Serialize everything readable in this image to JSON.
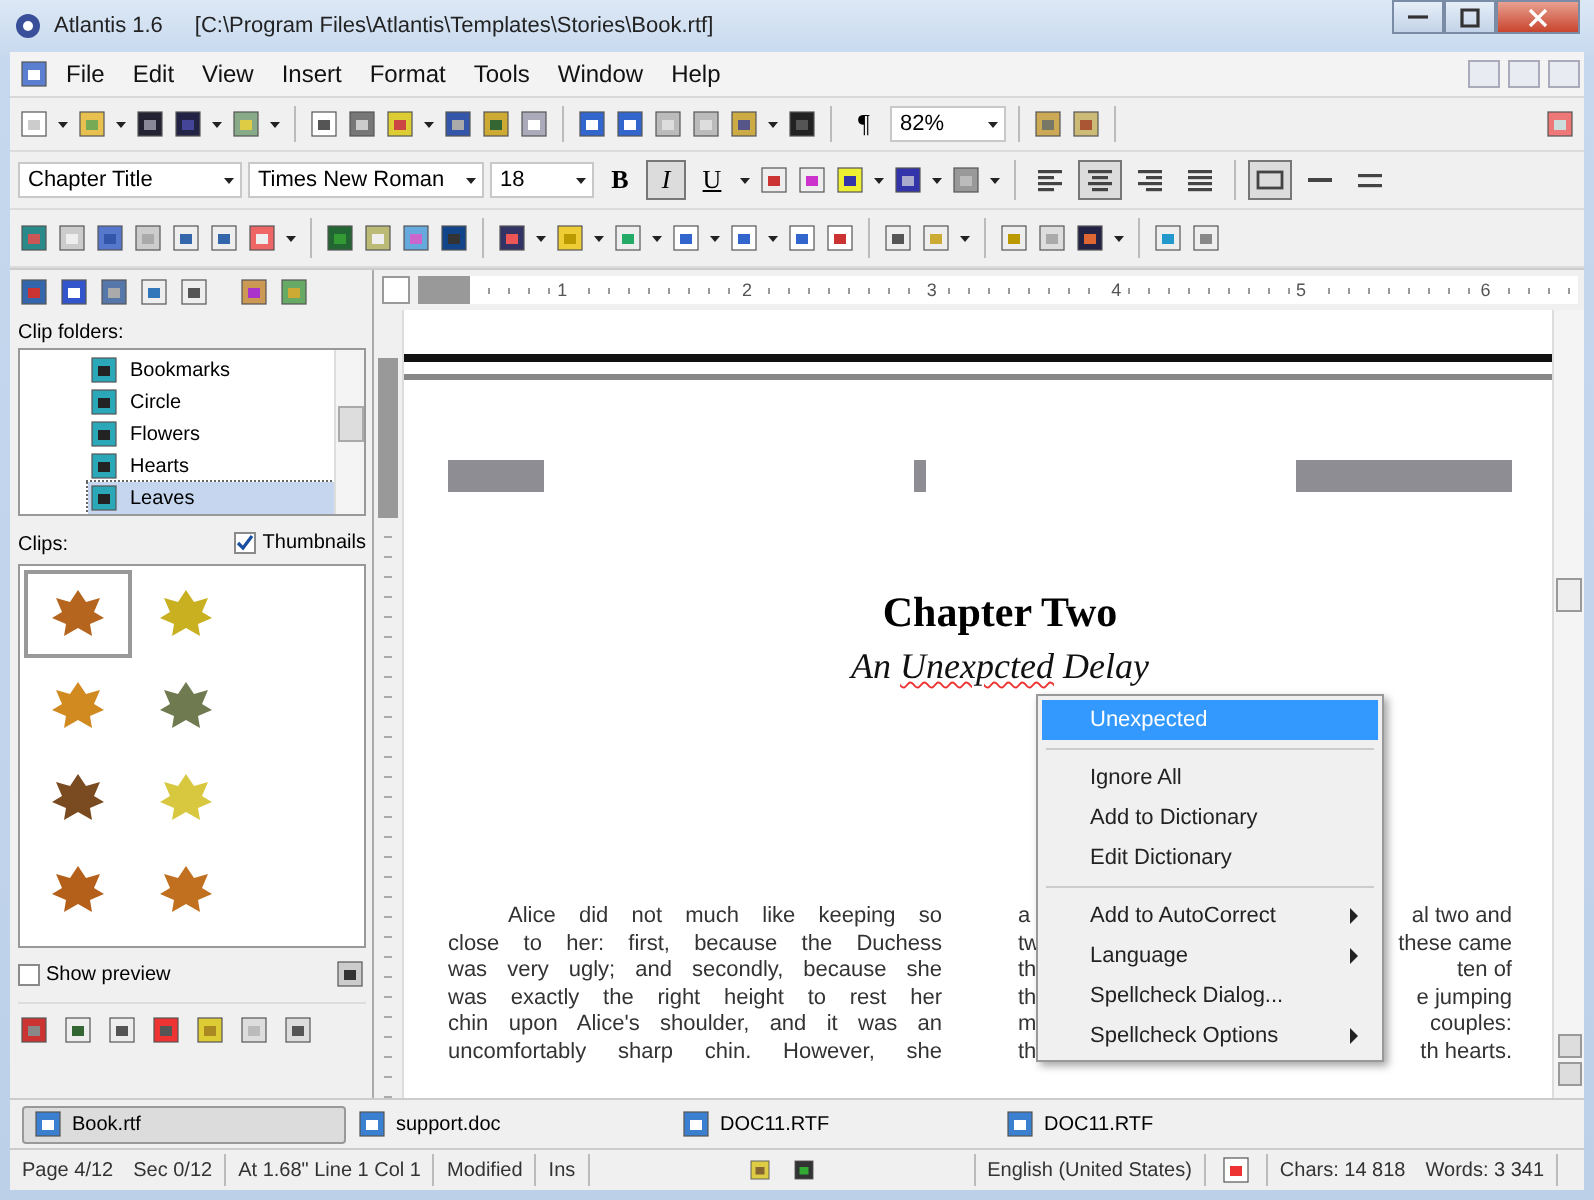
{
  "window": {
    "title": "Atlantis 1.6",
    "path": "[C:\\Program Files\\Atlantis\\Templates\\Stories\\Book.rtf]"
  },
  "menu": [
    "File",
    "Edit",
    "View",
    "Insert",
    "Format",
    "Tools",
    "Window",
    "Help"
  ],
  "standard_toolbar": {
    "paragraph_mark": "¶",
    "zoom": "82%"
  },
  "format_toolbar": {
    "style": "Chapter Title",
    "font": "Times New Roman",
    "size": "18",
    "buttons": [
      {
        "kind": "bold",
        "label": "B",
        "pressed": false
      },
      {
        "kind": "italic",
        "label": "I",
        "pressed": true
      },
      {
        "kind": "underline",
        "label": "U",
        "pressed": false
      }
    ],
    "alignment": [
      {
        "kind": "left",
        "selected": false
      },
      {
        "kind": "center",
        "selected": true
      },
      {
        "kind": "right",
        "selected": false
      },
      {
        "kind": "justify",
        "selected": false
      }
    ],
    "borders": [
      {
        "kind": "box",
        "pressed": true
      },
      {
        "kind": "single",
        "pressed": false
      },
      {
        "kind": "double",
        "pressed": false
      }
    ]
  },
  "ruler_numbers": [
    "1",
    "2",
    "3",
    "4",
    "5",
    "6"
  ],
  "side_panel": {
    "folders_label": "Clip folders:",
    "folders": [
      {
        "label": "Bookmarks",
        "selected": false
      },
      {
        "label": "Circle",
        "selected": false
      },
      {
        "label": "Flowers",
        "selected": false
      },
      {
        "label": "Hearts",
        "selected": false
      },
      {
        "label": "Leaves",
        "selected": true
      }
    ],
    "clips_label": "Clips:",
    "thumbnails": {
      "label": "Thumbnails",
      "checked": true
    },
    "clips": [
      {
        "color": "#b5651d",
        "selected": true
      },
      {
        "color": "#c8b020",
        "selected": false
      },
      {
        "color": "#d08a20",
        "selected": false
      },
      {
        "color": "#6f7a50",
        "selected": false
      },
      {
        "color": "#7a4a20",
        "selected": false
      },
      {
        "color": "#d8c840",
        "selected": false
      },
      {
        "color": "#b5601a",
        "selected": false
      },
      {
        "color": "#c0701f",
        "selected": false
      }
    ],
    "show_preview": {
      "label": "Show preview",
      "checked": false
    }
  },
  "document": {
    "title": "Chapter Two",
    "subtitle": {
      "before": "An ",
      "misspelled": "Unexpcted",
      "after": " Delay"
    },
    "left_column": [
      "Alice did not much like keeping so",
      "close to her: first, because the Duchess",
      "was very ugly; and secondly, because she",
      "was exactly the right height to rest her",
      "chin upon Alice's shoulder, and it was an",
      "uncomfortably sharp chin. However, she"
    ],
    "right_column": [
      {
        "start": "a",
        "end": "al two and"
      },
      {
        "start": "tw",
        "end": "these came"
      },
      {
        "start": "th",
        "end": "ten of"
      },
      {
        "start": "th",
        "end": "e jumping"
      },
      {
        "start": "m",
        "end": "couples:"
      },
      {
        "start": "th",
        "end": "th hearts."
      }
    ]
  },
  "context_menu": [
    {
      "kind": "suggestion",
      "label": "Unexpected",
      "selected": true
    },
    {
      "kind": "separator"
    },
    {
      "kind": "item",
      "label": "Ignore All",
      "selected": false
    },
    {
      "kind": "item",
      "label": "Add to Dictionary",
      "selected": false
    },
    {
      "kind": "item",
      "label": "Edit Dictionary",
      "selected": false
    },
    {
      "kind": "separator"
    },
    {
      "kind": "submenu",
      "label": "Add to AutoCorrect",
      "selected": false
    },
    {
      "kind": "submenu",
      "label": "Language",
      "selected": false
    },
    {
      "kind": "item",
      "label": "Spellcheck Dialog...",
      "selected": false
    },
    {
      "kind": "submenu",
      "label": "Spellcheck Options",
      "selected": false
    }
  ],
  "document_tabs": [
    {
      "label": "Book.rtf",
      "selected": true
    },
    {
      "label": "support.doc",
      "selected": false
    },
    {
      "label": "DOC11.RTF",
      "selected": false
    },
    {
      "label": "DOC11.RTF",
      "selected": false
    }
  ],
  "status_bar": {
    "page": "Page 4/12",
    "section": "Sec 0/12",
    "cursor": "At 1.68\" Line 1 Col 1",
    "modified": "Modified",
    "mode": "Ins",
    "language": "English (United States)",
    "chars": "Chars: 14 818",
    "words": "Words: 3 341"
  }
}
